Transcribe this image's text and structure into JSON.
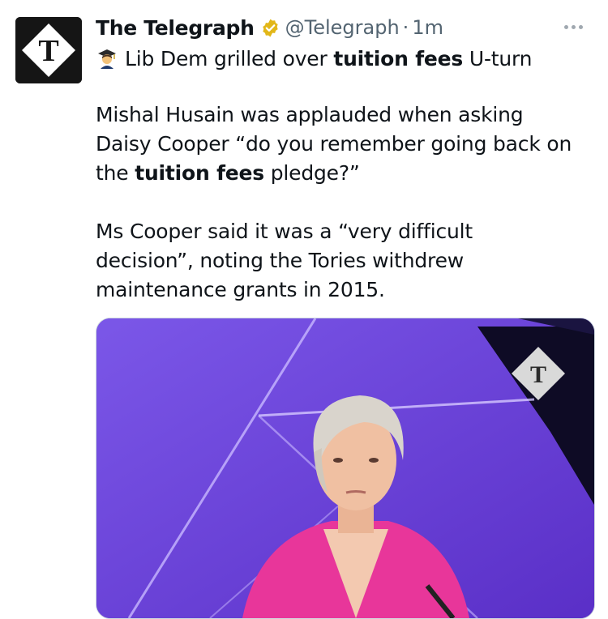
{
  "tweet": {
    "author_name": "The Telegraph",
    "handle": "@Telegraph",
    "separator": "·",
    "time": "1m",
    "verified_icon": "verified-badge-icon",
    "verified_color": "#e2b719",
    "more_icon": "more-icon",
    "headline_emoji": "student-emoji-icon",
    "headline": {
      "before": "Lib Dem grilled over ",
      "bold": "tuition fees",
      "after": " U-turn"
    },
    "paragraph2": {
      "line1": "Mishal Husain was applauded when asking",
      "line2": "Daisy Cooper “do you remember going back on",
      "line3_before": "the ",
      "line3_bold": "tuition fees",
      "line3_after": " pledge?”"
    },
    "paragraph3": {
      "line1": "Ms Cooper said it was a “very difficult",
      "line2": "decision”, noting the Tories withdrew",
      "line3": "maintenance grants in 2015."
    },
    "logo_letter": "T",
    "media": {
      "description_icon": "telegraph-logo-icon",
      "background_color": "#6a3fd6",
      "jacket_color": "#e8369a"
    }
  }
}
